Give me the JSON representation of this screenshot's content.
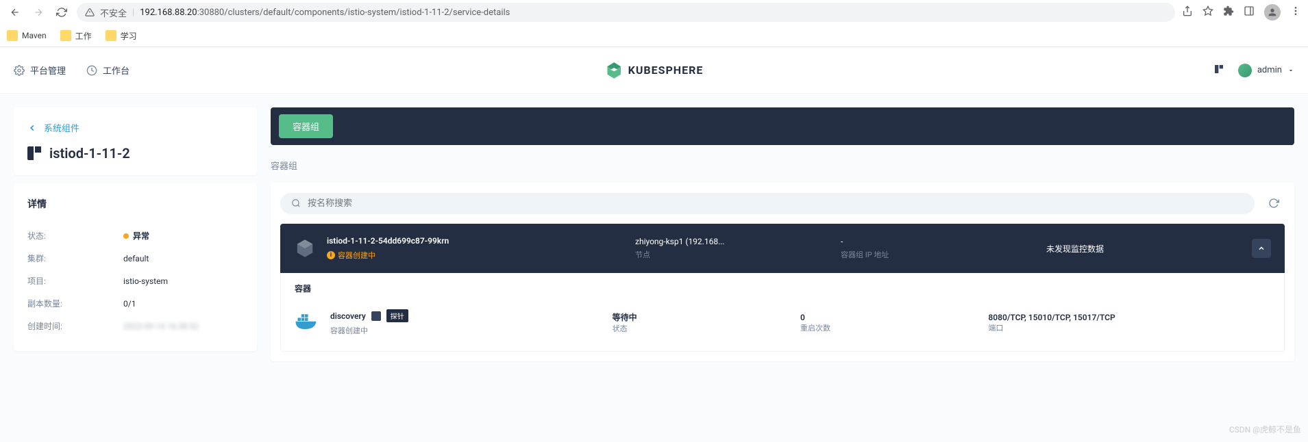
{
  "browser": {
    "url_prefix": "不安全",
    "url_host": "192.168.88.20",
    "url_port_path": ":30880/clusters/default/components/istio-system/istiod-1-11-2/service-details",
    "bookmarks": [
      {
        "label": "Maven"
      },
      {
        "label": "工作"
      },
      {
        "label": "学习"
      }
    ]
  },
  "header": {
    "platform_mgmt": "平台管理",
    "workbench": "工作台",
    "logo": "KUBESPHERE",
    "user": "admin"
  },
  "sidebar": {
    "breadcrumb": "系统组件",
    "title": "istiod-1-11-2",
    "details_title": "详情",
    "rows": {
      "status": {
        "label": "状态:",
        "value": "异常"
      },
      "cluster": {
        "label": "集群:",
        "value": "default"
      },
      "project": {
        "label": "项目:",
        "value": "istio-system"
      },
      "replicas": {
        "label": "副本数量:",
        "value": "0/1"
      },
      "created": {
        "label": "创建时间:",
        "value": "2022-09-14 16:38:52"
      }
    }
  },
  "content": {
    "tab_label": "容器组",
    "section_title": "容器组",
    "search_placeholder": "按名称搜索",
    "pod": {
      "name": "istiod-1-11-2-54dd699c87-99krn",
      "status": "容器创建中",
      "node_value": "zhiyong-ksp1  (192.168...",
      "node_label": "节点",
      "ip_value": "-",
      "ip_label": "容器组 IP 地址",
      "monitor": "未发现监控数据"
    },
    "container": {
      "section_label": "容器",
      "name": "discovery",
      "probe_badge": "探针",
      "status": "容器创建中",
      "state_value": "等待中",
      "state_label": "状态",
      "restart_value": "0",
      "restart_label": "重启次数",
      "ports_value": "8080/TCP, 15010/TCP, 15017/TCP",
      "ports_label": "端口"
    }
  },
  "watermark": "CSDN @虎鲸不是鱼"
}
